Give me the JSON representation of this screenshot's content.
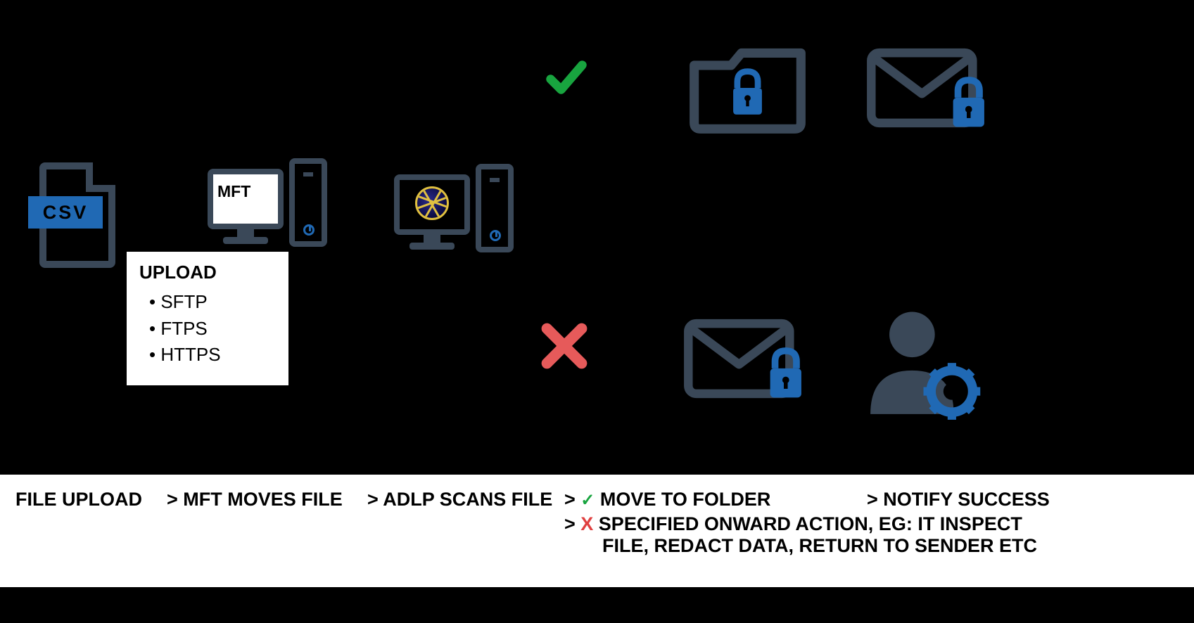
{
  "csv": {
    "label": "CSV"
  },
  "upload": {
    "title": "UPLOAD",
    "protocols": [
      "SFTP",
      "FTPS",
      "HTTPS"
    ]
  },
  "mft": {
    "label": "MFT"
  },
  "footer": {
    "step1": "FILE UPLOAD",
    "step2": "> MFT MOVES FILE",
    "step3": "> ADLP SCANS FILE",
    "step4_prefix": "> ",
    "step4_check": "✓",
    "step4_text": " MOVE TO FOLDER",
    "step5": "> NOTIFY SUCCESS",
    "fail_prefix": "> ",
    "fail_x": "X",
    "fail_line1": " SPECIFIED ONWARD ACTION, EG: IT INSPECT",
    "fail_line2": "FILE, REDACT DATA, RETURN TO SENDER ETC"
  },
  "colors": {
    "iconDark": "#3a4858",
    "accent": "#2069b4",
    "green": "#18a43f",
    "red": "#e65a5a"
  }
}
